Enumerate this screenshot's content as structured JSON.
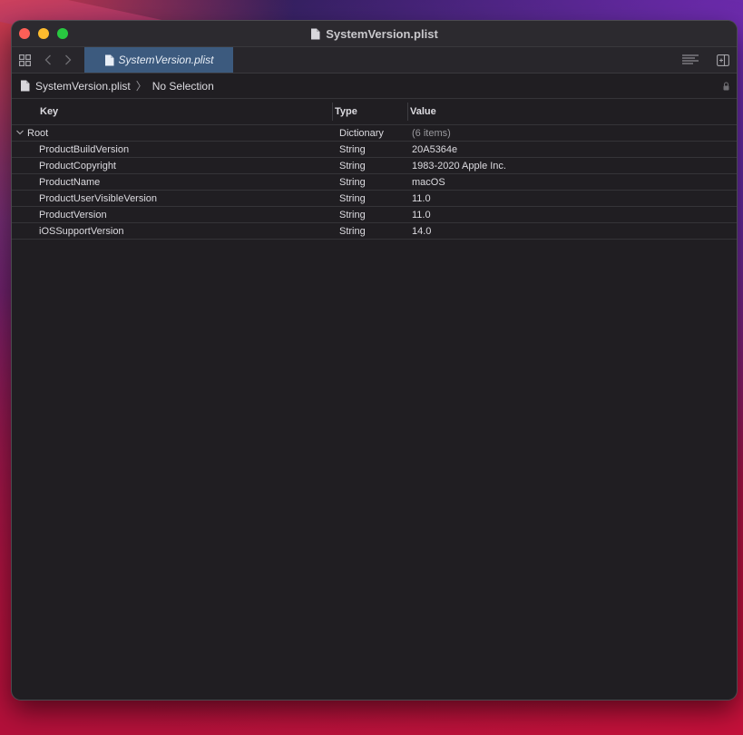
{
  "window": {
    "title": "SystemVersion.plist",
    "tab_label": "SystemVersion.plist"
  },
  "breadcrumb": {
    "file": "SystemVersion.plist",
    "selection": "No Selection"
  },
  "table": {
    "headers": {
      "key": "Key",
      "type": "Type",
      "value": "Value"
    },
    "root": {
      "key": "Root",
      "type": "Dictionary",
      "value": "(6 items)"
    },
    "rows": [
      {
        "key": "ProductBuildVersion",
        "type": "String",
        "value": "20A5364e"
      },
      {
        "key": "ProductCopyright",
        "type": "String",
        "value": "1983-2020 Apple Inc."
      },
      {
        "key": "ProductName",
        "type": "String",
        "value": "macOS"
      },
      {
        "key": "ProductUserVisibleVersion",
        "type": "String",
        "value": "11.0"
      },
      {
        "key": "ProductVersion",
        "type": "String",
        "value": "11.0"
      },
      {
        "key": "iOSSupportVersion",
        "type": "String",
        "value": "14.0"
      }
    ]
  },
  "icons": {
    "grid": "grid-icon",
    "back": "chevron-left-icon",
    "forward": "chevron-right-icon",
    "doc": "document-icon",
    "lines": "lines-icon",
    "inspector": "inspector-icon",
    "lock": "lock-icon",
    "disclosure": "chevron-down-icon"
  },
  "colors": {
    "close": "#fe5f57",
    "minimize": "#febc2e",
    "zoom": "#28c840",
    "tab_active": "#3c5a7e",
    "window_bg": "#201e22"
  }
}
